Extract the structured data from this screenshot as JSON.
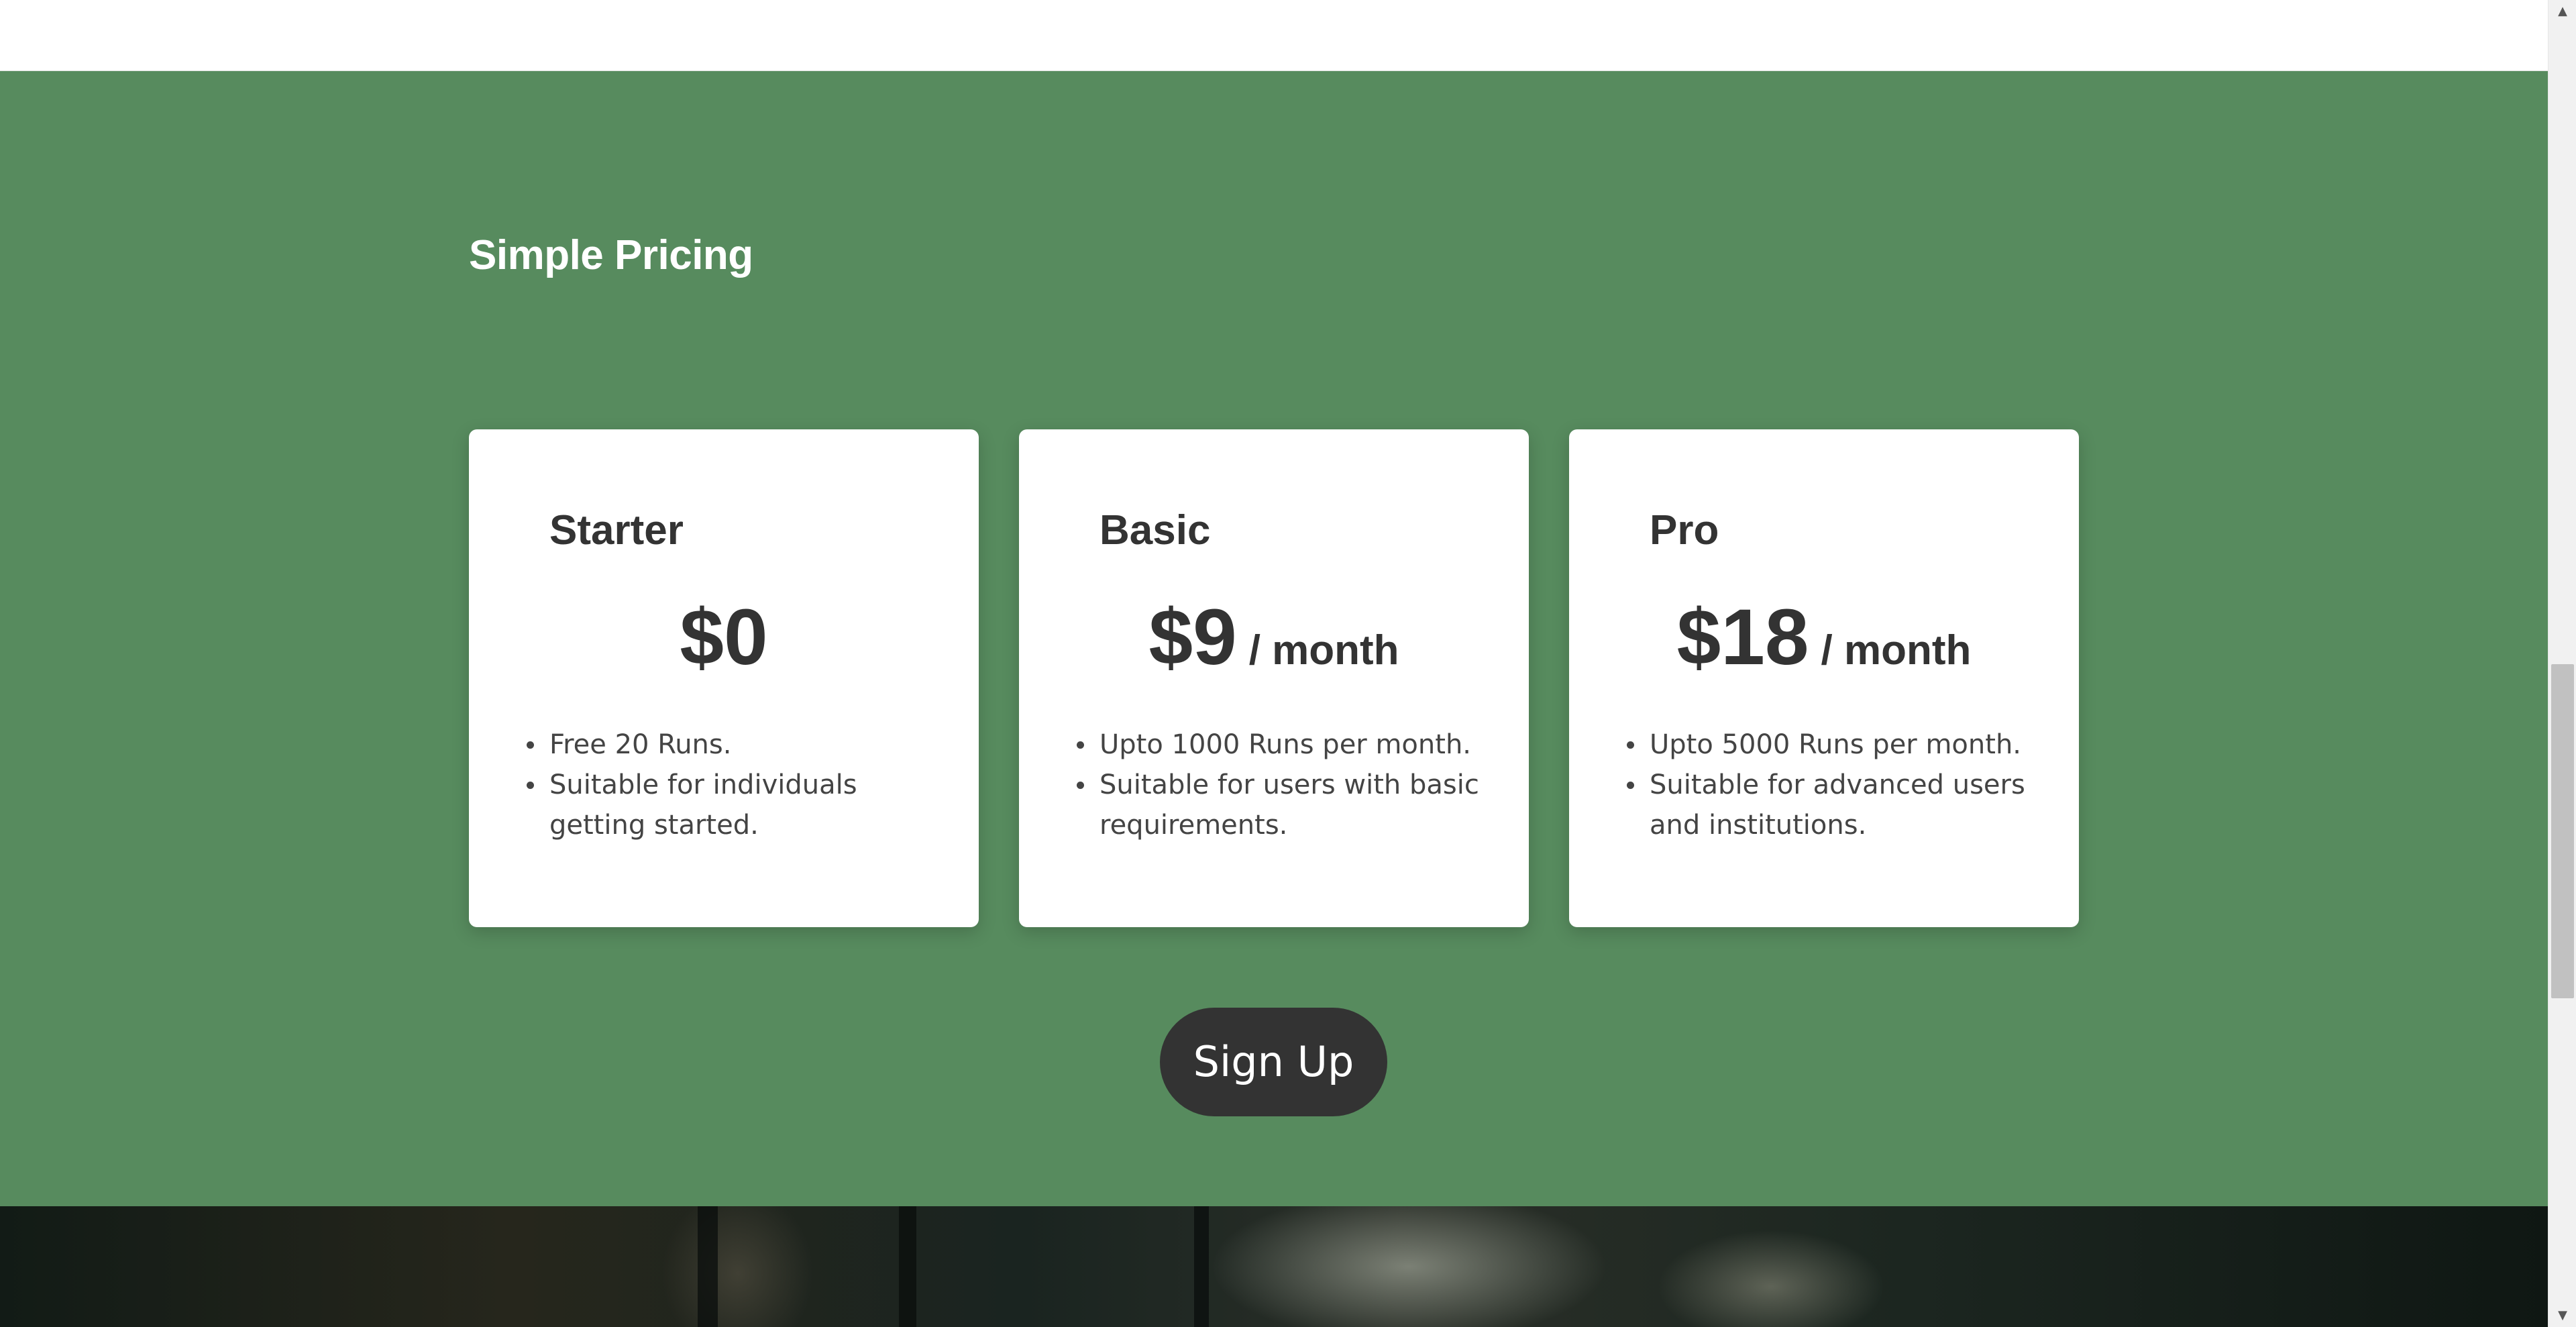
{
  "pricing": {
    "title": "Simple Pricing",
    "accent_color": "#578b5e",
    "plans": [
      {
        "name": "Starter",
        "price": "$0",
        "period": "",
        "features": [
          "Free 20 Runs.",
          "Suitable for individuals getting started."
        ]
      },
      {
        "name": "Basic",
        "price": "$9",
        "period": "/ month",
        "features": [
          "Upto 1000 Runs per month.",
          "Suitable for users with basic requirements."
        ]
      },
      {
        "name": "Pro",
        "price": "$18",
        "period": "/ month",
        "features": [
          "Upto 5000 Runs per month.",
          "Suitable for advanced users and institutions."
        ]
      }
    ],
    "signup_label": "Sign Up",
    "signup_color": "#333333"
  },
  "scrollbar": {
    "up_icon": "▲",
    "down_icon": "▼"
  }
}
